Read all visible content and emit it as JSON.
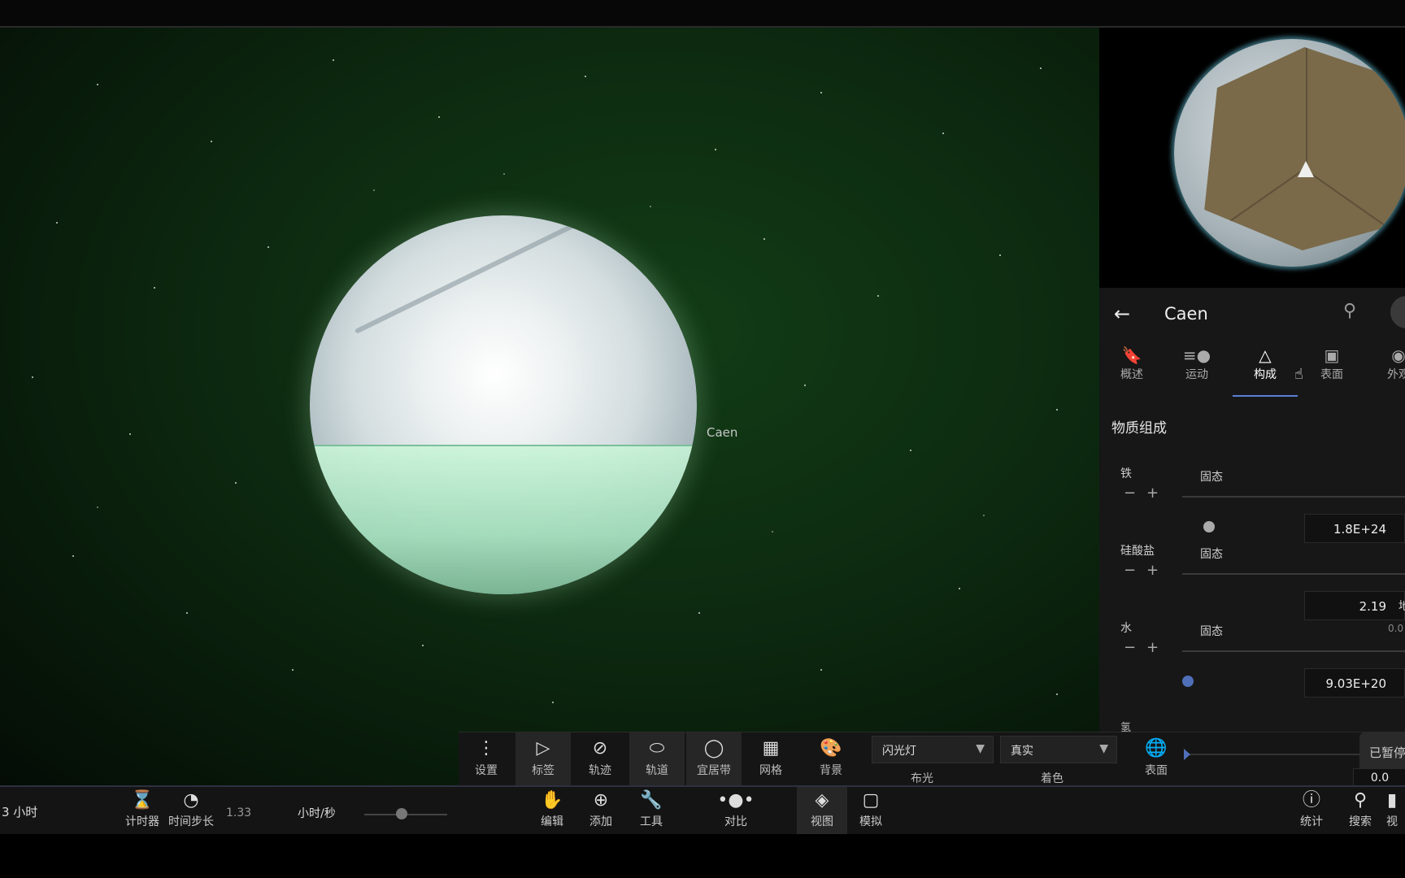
{
  "viewport": {
    "planet_label": "Caen"
  },
  "panel": {
    "title": "Caen",
    "back_icon": "arrow-left-icon",
    "tabs": [
      {
        "label": "概述",
        "icon": "bookmark-icon"
      },
      {
        "label": "运动",
        "icon": "motion-icon"
      },
      {
        "label": "构成",
        "icon": "composition-icon",
        "active": true
      },
      {
        "label": "表面",
        "icon": "surface-icon"
      },
      {
        "label": "外观",
        "icon": "palette-icon"
      }
    ],
    "section_title": "物质组成",
    "materials": [
      {
        "name": "铁",
        "state": "固态",
        "value": "1.8E+24",
        "unit": "",
        "side": "",
        "level": 0.12
      },
      {
        "name": "硅酸盐",
        "state": "固态",
        "value": "2.19",
        "unit": "地",
        "side": "",
        "level": 0.99
      },
      {
        "name": "水",
        "state": "固态",
        "value": "9.03E+20",
        "unit": "",
        "side": "0.0",
        "level": 0.0
      }
    ],
    "cut_label": "氢"
  },
  "toolbar": {
    "items": [
      {
        "label": "设置",
        "icon": "more-vertical-icon"
      },
      {
        "label": "标签",
        "icon": "tag-icon"
      },
      {
        "label": "轨迹",
        "icon": "trail-off-icon"
      },
      {
        "label": "轨道",
        "icon": "orbit-icon"
      },
      {
        "label": "宜居带",
        "icon": "ring-icon"
      },
      {
        "label": "网格",
        "icon": "grid-icon"
      },
      {
        "label": "背景",
        "icon": "palette-icon"
      }
    ],
    "lighting": {
      "value": "闪光灯",
      "label": "布光"
    },
    "coloring": {
      "value": "真实",
      "label": "着色"
    },
    "surface_label": "表面",
    "paused_label": "已暂停",
    "value": "0.0"
  },
  "bottombar": {
    "time_text": "3 小时",
    "timer_label": "计时器",
    "timestep_label": "时间步长",
    "timestep_value": "1.33",
    "rate_unit": "小时/秒",
    "rate_level": 0.45,
    "items": [
      {
        "label": "编辑",
        "icon": "hand-icon"
      },
      {
        "label": "添加",
        "icon": "plus-circle-icon"
      },
      {
        "label": "工具",
        "icon": "wrench-icon"
      },
      {
        "label": "对比",
        "icon": "compare-icon"
      },
      {
        "label": "视图",
        "icon": "layers-icon"
      },
      {
        "label": "模拟",
        "icon": "cube-icon"
      }
    ],
    "right_items": [
      {
        "label": "统计",
        "icon": "info-icon"
      },
      {
        "label": "搜索",
        "icon": "search-icon"
      },
      {
        "label": "视",
        "icon": "view-icon"
      }
    ]
  }
}
